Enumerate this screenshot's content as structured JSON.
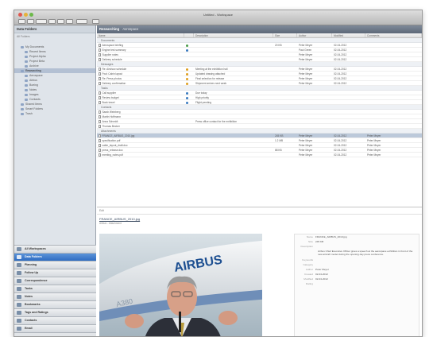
{
  "window": {
    "title": "Untitled - Workspace"
  },
  "sidebar": {
    "title": "Data Folders",
    "subtitle": "All Folders",
    "tree": [
      {
        "label": "My Documents",
        "indent": 1,
        "selected": false
      },
      {
        "label": "Recent Items",
        "indent": 2,
        "selected": false
      },
      {
        "label": "Project Alpha",
        "indent": 2,
        "selected": false
      },
      {
        "label": "Project Beta",
        "indent": 2,
        "selected": false
      },
      {
        "label": "Archive",
        "indent": 2,
        "selected": false
      },
      {
        "label": "Researching",
        "indent": 1,
        "selected": true
      },
      {
        "label": "Aerospace",
        "indent": 2,
        "selected": false
      },
      {
        "label": "Airbus",
        "indent": 2,
        "selected": false
      },
      {
        "label": "Boeing",
        "indent": 2,
        "selected": false
      },
      {
        "label": "Notes",
        "indent": 2,
        "selected": false
      },
      {
        "label": "Images",
        "indent": 2,
        "selected": false
      },
      {
        "label": "Contacts",
        "indent": 2,
        "selected": false
      },
      {
        "label": "Shared Items",
        "indent": 1,
        "selected": false
      },
      {
        "label": "Smart Folders",
        "indent": 1,
        "selected": false
      },
      {
        "label": "Trash",
        "indent": 1,
        "selected": false
      }
    ],
    "modules": [
      {
        "label": "All Workspaces",
        "active": false
      },
      {
        "label": "Data Folders",
        "active": true
      },
      {
        "label": "Planning",
        "active": false
      },
      {
        "label": "Follow Up",
        "active": false
      },
      {
        "label": "Correspondence",
        "active": false
      },
      {
        "label": "Tasks",
        "active": false
      },
      {
        "label": "Notes",
        "active": false
      },
      {
        "label": "Bookmarks",
        "active": false
      },
      {
        "label": "Tags and Ratings",
        "active": false
      },
      {
        "label": "Contacts",
        "active": false
      },
      {
        "label": "Email",
        "active": false
      }
    ]
  },
  "main": {
    "header": "Researching",
    "header_hint": "Aerospace",
    "columns": [
      "Name",
      "",
      "Description",
      "Size",
      "Author",
      "Modified",
      "Comments"
    ],
    "sections": [
      {
        "title": "Documents",
        "rows": [
          {
            "name": "Aerospace briefing",
            "desc": "",
            "size": "20 KB",
            "author": "Peter Meyer",
            "date": "02-04-2012",
            "comment": "",
            "icon": "#4a9d4a",
            "selected": false
          },
          {
            "name": "Engine test summary",
            "desc": "",
            "size": "",
            "author": "Paul Green",
            "date": "02-04-2012",
            "comment": "",
            "icon": "#3a7ac0",
            "selected": false
          },
          {
            "name": "Supplier notes",
            "desc": "",
            "size": "",
            "author": "Peter Meyer",
            "date": "02-04-2012",
            "comment": "",
            "icon": "",
            "selected": false
          },
          {
            "name": "Delivery schedule",
            "desc": "",
            "size": "",
            "author": "Peter Meyer",
            "date": "02-04-2012",
            "comment": "",
            "icon": "",
            "selected": false
          }
        ]
      },
      {
        "title": "Messages",
        "rows": [
          {
            "name": "Re: Airshow schedule",
            "desc": "Meeting at the exhibition hall",
            "size": "",
            "author": "Peter Meyer",
            "date": "02-04-2012",
            "comment": "",
            "icon": "#e0a020",
            "selected": false
          },
          {
            "name": "Fwd: Cabin layout",
            "desc": "Updated drawing attached",
            "size": "",
            "author": "Peter Meyer",
            "date": "02-04-2012",
            "comment": "",
            "icon": "#e0a020",
            "selected": false
          },
          {
            "name": "Re: Press photos",
            "desc": "Final selection for release",
            "size": "",
            "author": "Peter Meyer",
            "date": "02-04-2012",
            "comment": "",
            "icon": "#e0a020",
            "selected": false
          },
          {
            "name": "Delivery confirmation",
            "desc": "Shipment arrives next week",
            "size": "",
            "author": "Peter Meyer",
            "date": "02-04-2012",
            "comment": "",
            "icon": "#e0a020",
            "selected": false
          }
        ]
      },
      {
        "title": "Tasks",
        "rows": [
          {
            "name": "Call supplier",
            "desc": "Due today",
            "size": "",
            "author": "",
            "date": "",
            "comment": "",
            "icon": "#3a7ac0",
            "selected": false
          },
          {
            "name": "Review budget",
            "desc": "High priority",
            "size": "",
            "author": "",
            "date": "",
            "comment": "",
            "icon": "#3a7ac0",
            "selected": false
          },
          {
            "name": "Book travel",
            "desc": "Flight pending",
            "size": "",
            "author": "",
            "date": "",
            "comment": "",
            "icon": "#3a7ac0",
            "selected": false
          }
        ]
      },
      {
        "title": "Contacts",
        "rows": [
          {
            "name": "Sarah Weinberg",
            "desc": "",
            "size": "",
            "author": "",
            "date": "",
            "comment": "",
            "icon": "",
            "selected": false
          },
          {
            "name": "Martin Hoffmann",
            "desc": "",
            "size": "",
            "author": "",
            "date": "",
            "comment": "",
            "icon": "",
            "selected": false
          },
          {
            "name": "Anna Schmidt",
            "desc": "Press office contact for the exhibition",
            "size": "",
            "author": "",
            "date": "",
            "comment": "",
            "icon": "",
            "selected": false
          },
          {
            "name": "Thomas Becker",
            "desc": "",
            "size": "",
            "author": "",
            "date": "",
            "comment": "",
            "icon": "",
            "selected": false
          }
        ]
      },
      {
        "title": "Attachments",
        "rows": [
          {
            "name": "FRANCE_AIRBUS_2010.jpg",
            "desc": "",
            "size": "245 KB",
            "author": "Peter Meyer",
            "date": "02-04-2012",
            "comment": "Peter Meyer",
            "icon": "",
            "selected": true
          },
          {
            "name": "specification.pdf",
            "desc": "",
            "size": "1.2 MB",
            "author": "Peter Meyer",
            "date": "02-04-2012",
            "comment": "Peter Meyer",
            "icon": "",
            "selected": false
          },
          {
            "name": "cabin_layout_draft.doc",
            "desc": "",
            "size": "",
            "author": "Peter Meyer",
            "date": "02-04-2012",
            "comment": "Peter Meyer",
            "icon": "",
            "selected": false
          },
          {
            "name": "press_release.doc",
            "desc": "",
            "size": "88 KB",
            "author": "Peter Meyer",
            "date": "02-04-2012",
            "comment": "Peter Meyer",
            "icon": "",
            "selected": false
          },
          {
            "name": "meeting_notes.pdf",
            "desc": "",
            "size": "",
            "author": "Peter Meyer",
            "date": "02-04-2012",
            "comment": "Peter Meyer",
            "icon": "",
            "selected": false
          }
        ]
      }
    ]
  },
  "preview": {
    "toolbar": "Edit",
    "title": "FRANCE_AIRBUS_2010.jpg",
    "subtitle": "Airbus - Attachment",
    "photo_text": "AIRBUS",
    "photo_text2": "A380",
    "meta": [
      {
        "k": "Name",
        "v": "FRANCE_AIRBUS_2010.jpg"
      },
      {
        "k": "Size",
        "v": "245 KB"
      },
      {
        "k": "Description",
        "v": ""
      },
      {
        "k": "Keywords",
        "v": ""
      },
      {
        "k": "Category",
        "v": ""
      },
      {
        "k": "Author",
        "v": "Peter Meyer"
      },
      {
        "k": "Created",
        "v": "02-04-2012"
      },
      {
        "k": "Modified",
        "v": "02-04-2012"
      },
      {
        "k": "Rating",
        "v": ""
      }
    ],
    "description": "Airbus Chief Executive Officer gives a speech at the aerospace exhibition in front of the new aircraft model during the opening day press conference."
  },
  "colors": {
    "accent": "#2f6cc1",
    "selection": "#bcc9da",
    "header": "#5d6878"
  }
}
